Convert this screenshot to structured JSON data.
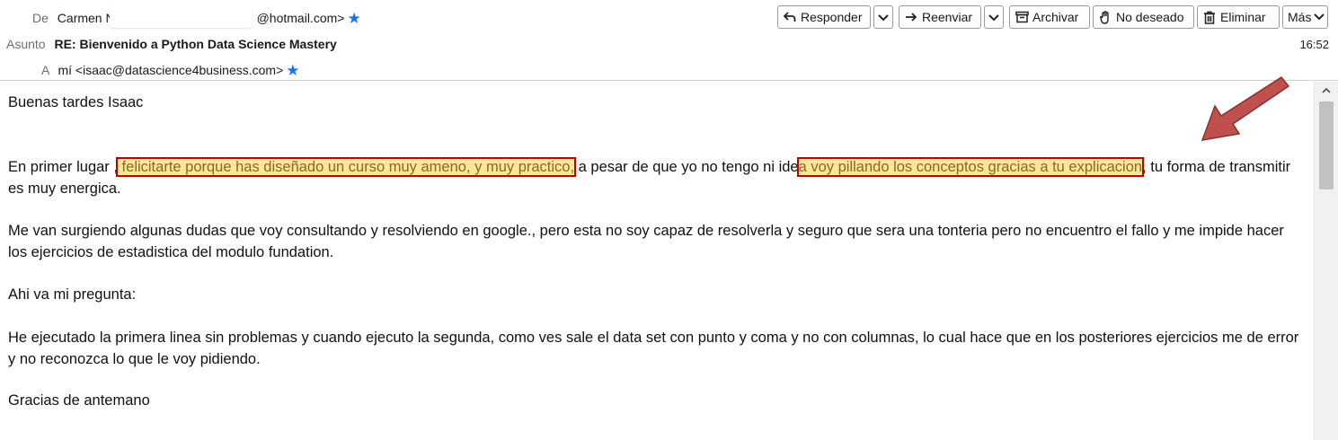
{
  "header": {
    "from_label": "De",
    "from_name": "Carmen N",
    "from_email_tail": "@hotmail.com>",
    "subject_label": "Asunto",
    "subject": "RE: Bienvenido a Python Data Science Mastery",
    "to_label": "A",
    "to": "mí <isaac@datascience4business.com>",
    "time": "16:52"
  },
  "toolbar": {
    "reply": "Responder",
    "forward": "Reenviar",
    "archive": "Archivar",
    "junk": "No deseado",
    "delete": "Eliminar",
    "more": "Más"
  },
  "message": {
    "greeting": "Buenas tardes Isaac",
    "p1_a": "En primer lugar ,",
    "p1_hl1": " felicitarte porque has diseñado un curso muy ameno, y muy practico,",
    "p1_b": " a pesar de que yo no tengo ni ide",
    "p1_hl2": "a voy pillando los conceptos gracias a tu explicacion",
    "p1_c": ", tu forma de transmitir es muy energica.",
    "p2": "Me van surgiendo algunas dudas que voy consultando y resolviendo en google., pero esta no soy capaz de resolverla y seguro que sera una tonteria pero no encuentro el fallo y me impide hacer los ejercicios de estadistica del modulo fundation.",
    "p3": "Ahi va mi pregunta:",
    "p4": "He  ejecutado la primera linea sin problemas y cuando ejecuto la segunda, como ves sale el data set con  punto  y coma  y no con columnas, lo cual hace que en los posteriores ejercicios me de error y no reconozca lo que le voy pidiendo.",
    "p5": "Gracias de antemano"
  },
  "colors": {
    "highlight_fill": "#fbe79a",
    "highlight_border": "#c00000",
    "annotation_arrow": "#c0504d",
    "star": "#1a73e8"
  }
}
